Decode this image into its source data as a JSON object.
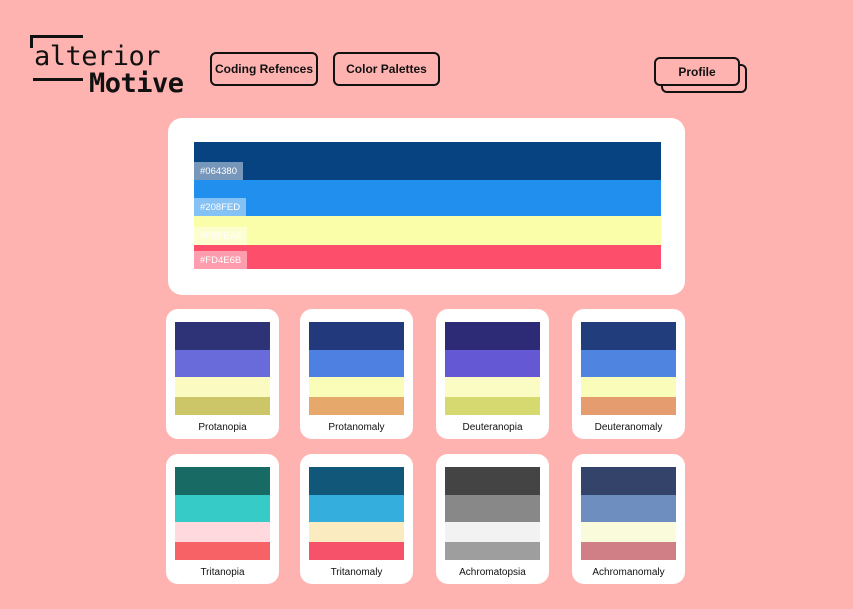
{
  "logo": {
    "line1": "alterior",
    "line2": "Motive"
  },
  "nav": {
    "coding_references": "Coding Refences",
    "color_palettes": "Color Palettes",
    "profile": "Profile"
  },
  "palette": [
    {
      "hex": "#064380",
      "label": "#064380"
    },
    {
      "hex": "#208FED",
      "label": "#208FED"
    },
    {
      "hex": "#FBFEA8",
      "label": "#FBFEA8"
    },
    {
      "hex": "#FD4E6B",
      "label": "#FD4E6B"
    }
  ],
  "simulations": [
    {
      "name": "Protanopia",
      "colors": [
        "#2E3277",
        "#6A6BDB",
        "#FBFBC1",
        "#CDC668"
      ]
    },
    {
      "name": "Protanomaly",
      "colors": [
        "#22397B",
        "#4D80E0",
        "#FAFDB8",
        "#E7A86B"
      ]
    },
    {
      "name": "Deuteranopia",
      "colors": [
        "#2D2A76",
        "#6458D4",
        "#FBFBC4",
        "#D6D96F"
      ]
    },
    {
      "name": "Deuteranomaly",
      "colors": [
        "#223D7C",
        "#4F84E1",
        "#FAFCBA",
        "#E59D70"
      ]
    },
    {
      "name": "Tritanopia",
      "colors": [
        "#186A65",
        "#36CBC6",
        "#FFD9DE",
        "#F66265"
      ]
    },
    {
      "name": "Tritanomaly",
      "colors": [
        "#10577A",
        "#34AEDD",
        "#FAEBC0",
        "#F6536B"
      ]
    },
    {
      "name": "Achromatopsia",
      "colors": [
        "#444444",
        "#888888",
        "#F2F2F2",
        "#9E9E9E"
      ]
    },
    {
      "name": "Achromanomaly",
      "colors": [
        "#34436A",
        "#6E8EBF",
        "#FAFBDB",
        "#D07F86"
      ]
    }
  ]
}
